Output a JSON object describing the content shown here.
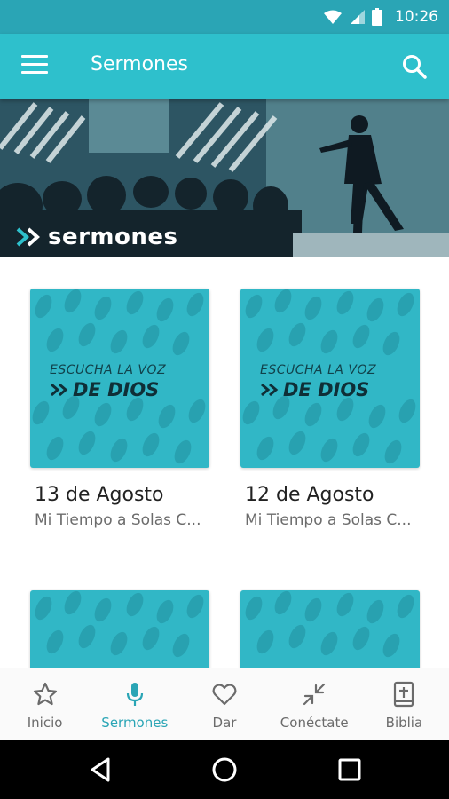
{
  "status_bar": {
    "time": "10:26",
    "icons": [
      "wifi-icon",
      "signal-icon",
      "battery-icon"
    ]
  },
  "app_bar": {
    "title": "Sermones",
    "menu_icon": "menu-icon",
    "search_icon": "search-icon"
  },
  "hero": {
    "label": "sermones"
  },
  "cards": [
    {
      "thumb_line1": "ESCUCHA LA VOZ",
      "thumb_line2": "DE DIOS",
      "title": "13 de Agosto",
      "subtitle": "Mi Tiempo a Solas C..."
    },
    {
      "thumb_line1": "ESCUCHA LA VOZ",
      "thumb_line2": "DE DIOS",
      "title": "12 de Agosto",
      "subtitle": "Mi Tiempo a Solas C..."
    },
    {
      "thumb_line1": "",
      "thumb_line2": "",
      "title": "",
      "subtitle": ""
    },
    {
      "thumb_line1": "",
      "thumb_line2": "",
      "title": "",
      "subtitle": ""
    }
  ],
  "bottom_nav": {
    "items": [
      {
        "label": "Inicio",
        "icon": "star-icon",
        "active": false
      },
      {
        "label": "Sermones",
        "icon": "microphone-icon",
        "active": true
      },
      {
        "label": "Dar",
        "icon": "heart-icon",
        "active": false
      },
      {
        "label": "Conéctate",
        "icon": "collapse-arrows-icon",
        "active": false
      },
      {
        "label": "Biblia",
        "icon": "bible-icon",
        "active": false
      }
    ]
  },
  "colors": {
    "accent": "#2ec0cc",
    "status_bar": "#2aa5b5",
    "card": "#31b7c6",
    "inactive_nav": "#6b6b6b"
  }
}
